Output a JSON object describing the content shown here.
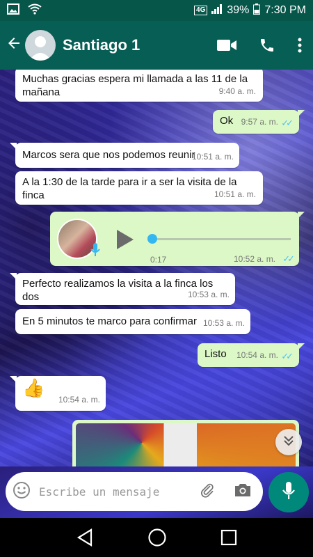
{
  "status_bar": {
    "network": "4G",
    "battery": "39%",
    "time": "7:30 PM"
  },
  "header": {
    "contact_name": "Santiago 1"
  },
  "messages": [
    {
      "direction": "in",
      "text": "Muchas gracias espera mi llamada a las 11 de la mañana",
      "time": "9:40 a. m."
    },
    {
      "direction": "out",
      "text": "Ok",
      "time": "9:57 a. m.",
      "status": "read"
    },
    {
      "direction": "in",
      "text": "Marcos sera que nos podemos reunir",
      "time": "10:51 a. m."
    },
    {
      "direction": "in",
      "text": "A la 1:30 de la tarde para ir a ser la visita de la finca",
      "time": "10:51 a. m."
    },
    {
      "direction": "out",
      "type": "voice",
      "duration": "0:17",
      "time": "10:52 a. m.",
      "status": "read",
      "progress": 0
    },
    {
      "direction": "in",
      "text": "Perfecto realizamos la visita a la finca los dos",
      "time": "10:53 a. m."
    },
    {
      "direction": "in",
      "text": "En 5 minutos te marco para confirmar",
      "time": "10:53 a. m."
    },
    {
      "direction": "out",
      "text": "Listo",
      "time": "10:54 a. m.",
      "status": "read"
    },
    {
      "direction": "in",
      "type": "emoji",
      "text": "👍",
      "time": "10:54 a. m."
    },
    {
      "direction": "out",
      "type": "image"
    }
  ],
  "composer": {
    "placeholder": "Escribe un mensaje"
  },
  "colors": {
    "header": "#075e54",
    "outgoing_bubble": "#dcf8c6",
    "incoming_bubble": "#ffffff",
    "read_ticks": "#4fc3f7",
    "fab": "#00897b"
  },
  "icons": [
    "back-arrow-icon",
    "video-call-icon",
    "phone-icon",
    "more-vert-icon",
    "emoji-icon",
    "attach-icon",
    "camera-icon",
    "mic-icon",
    "chevron-down-icon"
  ]
}
